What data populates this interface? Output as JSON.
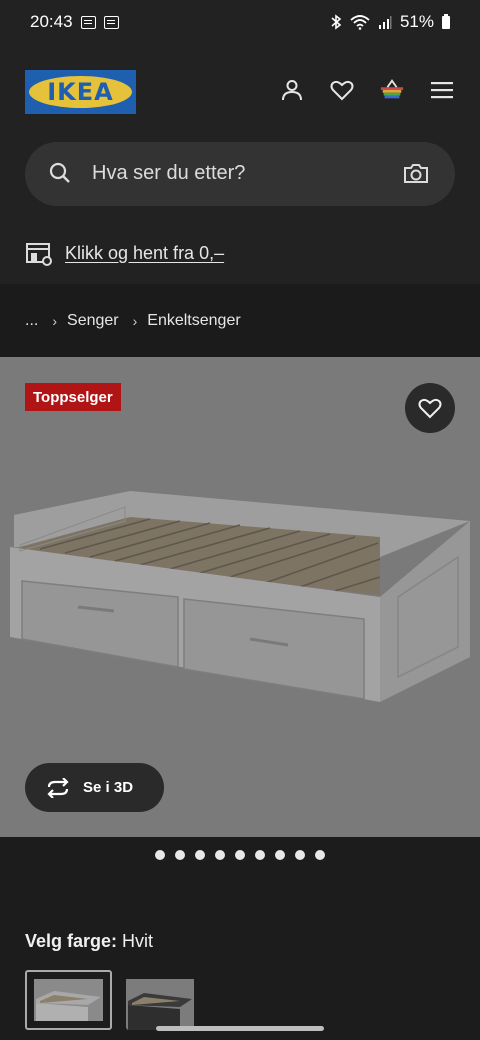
{
  "status_bar": {
    "time": "20:43",
    "battery": "51%"
  },
  "header": {
    "logo_text": "IKEA"
  },
  "search": {
    "placeholder": "Hva ser du etter?"
  },
  "click_collect": {
    "label": "Klikk og hent fra 0,–"
  },
  "breadcrumb": {
    "items": [
      "...",
      "Senger",
      "Enkeltsenger"
    ]
  },
  "product": {
    "badge": "Toppselger",
    "view3d_label": "Se i 3D",
    "image_dots": 9
  },
  "color_picker": {
    "title": "Velg farge:",
    "selected": "Hvit"
  },
  "colors": {
    "brand_blue": "#1f5fb0",
    "brand_yellow": "#e5c23a",
    "badge_red": "#b01414"
  }
}
